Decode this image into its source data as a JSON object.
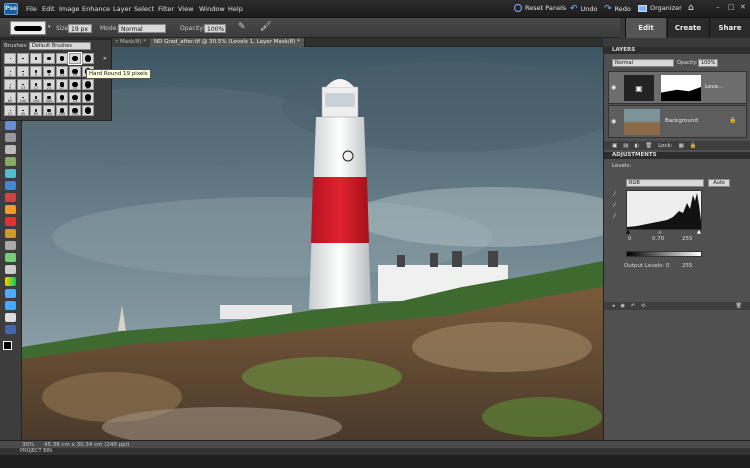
{
  "app": {
    "logo": "Pse"
  },
  "menu": [
    "File",
    "Edit",
    "Image",
    "Enhance",
    "Layer",
    "Select",
    "Filter",
    "View",
    "Window",
    "Help"
  ],
  "topbar": {
    "reset_panels": "Reset Panels",
    "undo": "Undo",
    "redo": "Redo",
    "organizer": "Organizer"
  },
  "modes": {
    "edit": "Edit",
    "create": "Create",
    "share": "Share"
  },
  "options": {
    "size_label": "Size:",
    "size_value": "19 px",
    "mode_label": "Mode:",
    "mode_value": "Normal",
    "opacity_label": "Opacity:",
    "opacity_value": "100%"
  },
  "tabs": [
    "r Mask/8) *",
    "ND Grad_after.tif @ 30.5% (Levels 1, Layer Mask/8) *"
  ],
  "brushes": {
    "label": "Brushes:",
    "set": "Default Brushes",
    "sizes": [
      "1",
      "3",
      "5",
      "9",
      "13",
      "19",
      "5",
      "9",
      "13",
      "17",
      "21",
      "27",
      "35",
      "45",
      "65",
      "100",
      "200",
      "300",
      "9",
      "13",
      "19",
      "17",
      "45",
      "65",
      "100",
      "200",
      "300"
    ],
    "tooltip": "Hard Round 19 pixels"
  },
  "layers": {
    "title": "LAYERS",
    "blend": "Normal",
    "opacity_label": "Opacity:",
    "opacity_value": "100%",
    "items": [
      {
        "name": "Leve..."
      },
      {
        "name": "Background"
      }
    ],
    "lock_label": "Lock:"
  },
  "adjustments": {
    "title": "ADJUSTMENTS",
    "type": "Levels:",
    "channel": "RGB",
    "auto": "Auto",
    "input_values": [
      "0",
      "0.70",
      "255"
    ],
    "output_label": "Output Levels:",
    "output_values": [
      "0",
      "255"
    ]
  },
  "status": {
    "zoom": "30%",
    "doc_size": "45.38 cm x 30.34 cm (240 ppi)"
  },
  "projectbin": {
    "label": "PROJECT BIN"
  },
  "colors": {
    "sky": "#4e6572",
    "tower_red": "#d3202d",
    "bg": "#3a3a3a"
  }
}
